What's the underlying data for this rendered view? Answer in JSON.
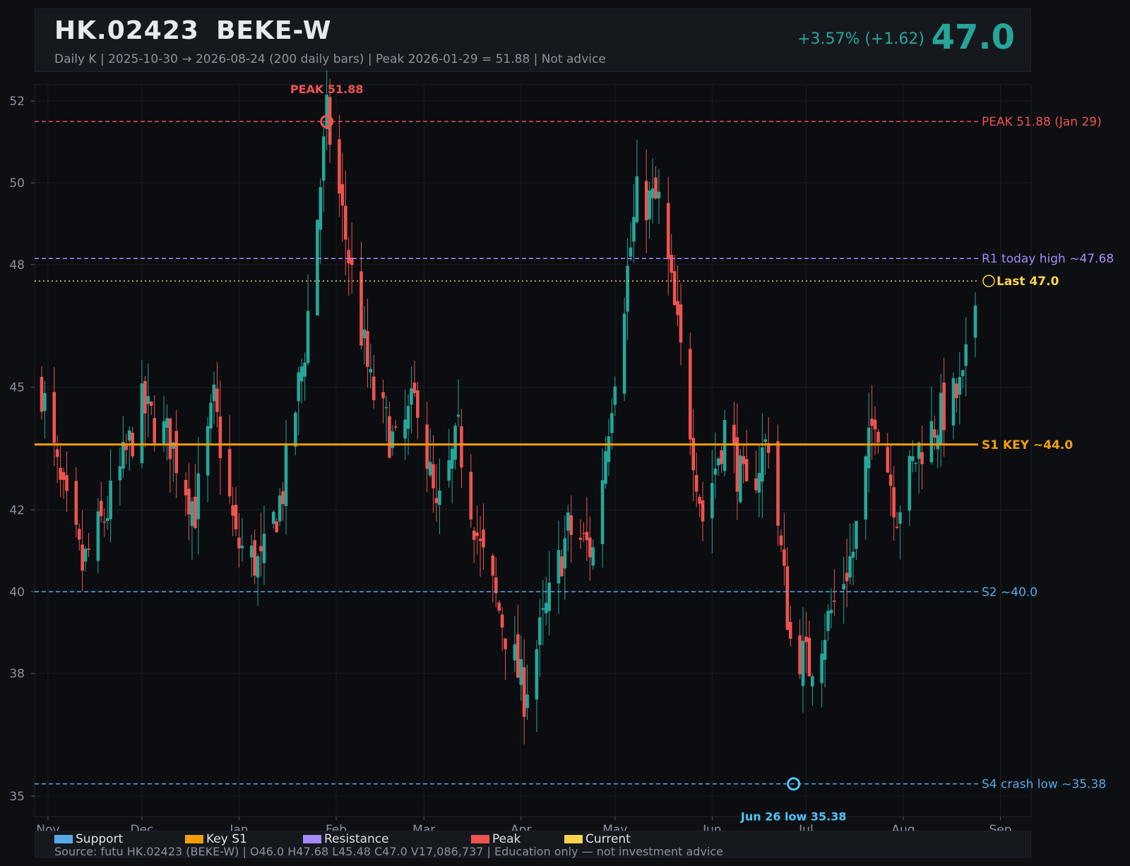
{
  "header": {
    "ticker": "HK.02423",
    "name": "BEKE-W",
    "subtitle": "Daily K  |  2025-10-30 → 2026-08-24 (200 daily bars)  |  Peak 2026-01-29 = 51.88  |  Not advice",
    "change": "+3.57%  (+1.62)",
    "price": "47.0"
  },
  "colors": {
    "up": "#26a69a",
    "down": "#ef5350",
    "peak": "#ef5350",
    "resistance": "#a78bfa",
    "current": "#fcd34d",
    "key_support": "#f59e0b",
    "support": "#5aa9e6",
    "crash_low": "#4fc3f7"
  },
  "chart_data": {
    "type": "candlestick",
    "x_start": "2025-10-30",
    "x_end": "2026-08-24",
    "ylim": [
      34.5,
      52.4
    ],
    "yticks": [
      35,
      38,
      40,
      42,
      45,
      48,
      50,
      52
    ],
    "xticks": [
      "Nov",
      "Dec",
      "Jan",
      "Feb",
      "Mar",
      "Apr",
      "May",
      "Jun",
      "Jul",
      "Aug",
      "Sep"
    ],
    "close_path": [
      [
        "2025-10-30",
        45.0
      ],
      [
        "2025-11-05",
        42.5
      ],
      [
        "2025-11-12",
        40.6
      ],
      [
        "2025-11-20",
        42.0
      ],
      [
        "2025-12-01",
        44.5
      ],
      [
        "2025-12-10",
        43.7
      ],
      [
        "2025-12-18",
        42.0
      ],
      [
        "2025-12-24",
        44.6
      ],
      [
        "2025-12-31",
        41.2
      ],
      [
        "2026-01-08",
        40.6
      ],
      [
        "2026-01-15",
        42.5
      ],
      [
        "2026-01-22",
        46.0
      ],
      [
        "2026-01-29",
        51.6
      ],
      [
        "2026-02-05",
        48.2
      ],
      [
        "2026-02-12",
        45.0
      ],
      [
        "2026-02-20",
        43.5
      ],
      [
        "2026-02-27",
        44.8
      ],
      [
        "2026-03-05",
        41.8
      ],
      [
        "2026-03-12",
        43.8
      ],
      [
        "2026-03-19",
        41.0
      ],
      [
        "2026-03-26",
        39.3
      ],
      [
        "2026-04-02",
        37.5
      ],
      [
        "2026-04-09",
        39.5
      ],
      [
        "2026-04-16",
        41.5
      ],
      [
        "2026-04-24",
        41.0
      ],
      [
        "2026-05-01",
        45.5
      ],
      [
        "2026-05-08",
        49.6
      ],
      [
        "2026-05-15",
        49.5
      ],
      [
        "2026-05-22",
        45.8
      ],
      [
        "2026-05-29",
        41.8
      ],
      [
        "2026-06-05",
        44.0
      ],
      [
        "2026-06-12",
        42.3
      ],
      [
        "2026-06-19",
        43.8
      ],
      [
        "2026-06-26",
        38.8
      ],
      [
        "2026-07-02",
        38.2
      ],
      [
        "2026-07-09",
        39.5
      ],
      [
        "2026-07-16",
        41.0
      ],
      [
        "2026-07-23",
        44.5
      ],
      [
        "2026-07-30",
        42.0
      ],
      [
        "2026-08-06",
        43.5
      ],
      [
        "2026-08-13",
        44.3
      ],
      [
        "2026-08-20",
        45.0
      ],
      [
        "2026-08-24",
        47.0
      ]
    ],
    "levels": [
      {
        "label": "PEAK 51.88 (Jan 29)",
        "value": 51.5,
        "style": "dashed",
        "color": "peak"
      },
      {
        "label": "R1 today high ~47.68",
        "value": 48.15,
        "style": "dashed",
        "color": "resistance"
      },
      {
        "label": "Last 47.0",
        "value": 47.6,
        "style": "dotted",
        "color": "current"
      },
      {
        "label": "S1 KEY ~44.0",
        "value": 43.6,
        "style": "solid",
        "color": "key_support"
      },
      {
        "label": "S2 ~40.0",
        "value": 40.0,
        "style": "dashed",
        "color": "support"
      },
      {
        "label": "S4 crash low ~35.38",
        "value": 35.3,
        "style": "dashed",
        "color": "support"
      }
    ],
    "annotations": [
      {
        "text": "PEAK 51.88",
        "date": "2026-01-29",
        "value": 51.5,
        "color": "peak"
      },
      {
        "text": "Jun 26 low 35.38",
        "date": "2026-06-27",
        "value": 35.3,
        "color": "crash_low"
      }
    ]
  },
  "legend": [
    {
      "label": "Support",
      "color": "#5aa9e6"
    },
    {
      "label": "Key S1",
      "color": "#f59e0b"
    },
    {
      "label": "Resistance",
      "color": "#a78bfa"
    },
    {
      "label": "Peak",
      "color": "#ef5350"
    },
    {
      "label": "Current",
      "color": "#fcd34d"
    }
  ],
  "source": "Source: futu HK.02423 (BEKE-W)  |  O46.0  H47.68  L45.48  C47.0  V17,086,737  |  Education only — not investment advice"
}
